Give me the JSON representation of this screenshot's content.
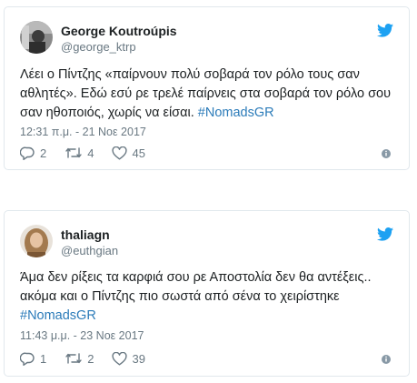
{
  "tweets": [
    {
      "name": "George Koutroúpis",
      "handle": "@george_ktrp",
      "text": "Λέει ο Πίντζης «παίρνουν πολύ σοβαρά τον ρόλο τους σαν\nαθλητές». Εδώ εσύ ρε τρελέ παίρνεις στα σοβαρά τον ρόλο σου\nσαν ηθοποιός, χωρίς να είσαι. ",
      "hashtag": "#NomadsGR",
      "timestamp": "12:31 π.μ. - 21 Νοε 2017",
      "replies": "2",
      "retweets": "4",
      "likes": "45"
    },
    {
      "name": "thaliagn",
      "handle": "@euthgian",
      "text": "Άμα δεν ρίξεις τα καρφιά σου ρε Αποστολία δεν θα αντέξεις..\nακόμα και ο Πίντζης πιο σωστά από σένα το χειρίστηκε\n",
      "hashtag": "#NomadsGR",
      "timestamp": "11:43 μ.μ. - 23 Νοε 2017",
      "replies": "1",
      "retweets": "2",
      "likes": "39"
    }
  ],
  "colors": {
    "accent": "#2b7bb9",
    "bird": "#1da1f2",
    "meta": "#697882",
    "border": "#e1e8ed"
  },
  "icons": [
    "twitter-bird-icon",
    "reply-icon",
    "retweet-icon",
    "like-icon",
    "info-icon"
  ]
}
